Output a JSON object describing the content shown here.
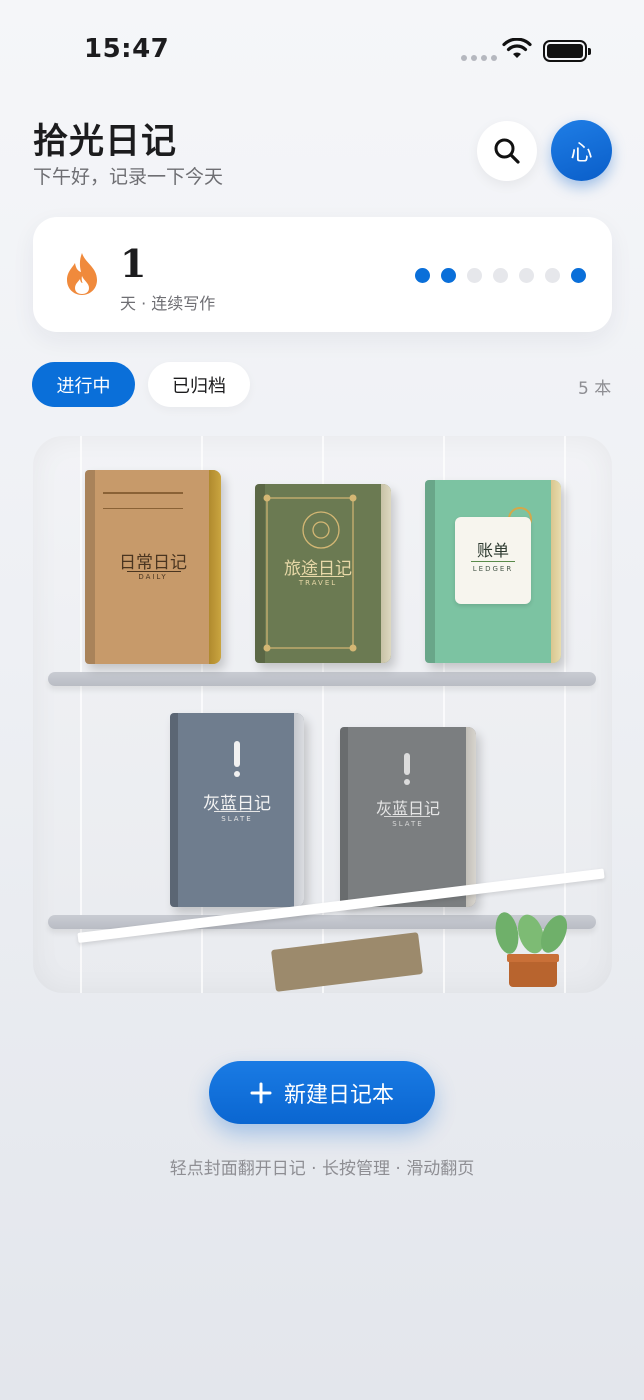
{
  "status_bar": {
    "time": "15:47"
  },
  "header": {
    "title": "拾光日记",
    "subtitle": "下午好，记录一下今天",
    "avatar_text": "心",
    "search_icon": "search-icon"
  },
  "streak": {
    "count": "1",
    "label": "天 · 连续写作",
    "icon": "flame-icon",
    "days": [
      true,
      true,
      false,
      false,
      false,
      false,
      true
    ],
    "accent": "#0a6fd9"
  },
  "tabs": {
    "active": "进行中",
    "archived": "已归档",
    "count": "5 本"
  },
  "notebooks": [
    {
      "title": "日常日记",
      "subtitle": "DAILY",
      "color": "#c79a6a"
    },
    {
      "title": "旅途日记",
      "subtitle": "TRAVEL",
      "color": "#6b7a52"
    },
    {
      "title": "账单",
      "subtitle": "LEDGER",
      "color": "#7cc3a2"
    },
    {
      "title": "灰蓝日记",
      "subtitle": "SLATE",
      "color": "#6f7d8e"
    },
    {
      "title": "灰蓝日记",
      "subtitle": "SLATE",
      "color": "#7b7e80"
    }
  ],
  "actions": {
    "new_notebook": "新建日记本",
    "hint": "轻点封面翻开日记 · 长按管理 · 滑动翻页"
  }
}
